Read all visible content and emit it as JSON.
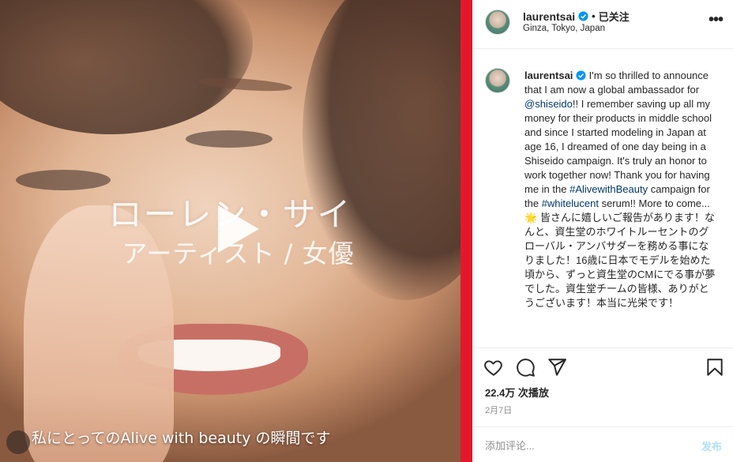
{
  "video": {
    "title_overlay": "ローレン・サイ",
    "subtitle_overlay": "アーティスト / 女優",
    "caption": "私にとってのAlive with beauty の瞬間です",
    "play_icon": "play-icon"
  },
  "post_header": {
    "username": "laurentsai",
    "separator": "•",
    "follow_label": "已关注",
    "location": "Ginza, Tokyo, Japan",
    "more_icon": "more-horizontal-icon"
  },
  "caption": {
    "username": "laurentsai",
    "text_1": " I'm so thrilled to announce that I am now a global ambassador for ",
    "mention": "@shiseido",
    "text_2": "!! I remember saving up all my money for their products in middle school and since I started modeling in Japan at age 16, I dreamed of one day being in a Shiseido campaign. It's truly an honor to work together now! Thank you for having me in the ",
    "hashtag_1": "#AlivewithBeauty",
    "text_3": " campaign for the ",
    "hashtag_2": "#whitelucent",
    "text_4": " serum!! More to come...",
    "star": "🌟",
    "jp_text": "皆さんに嬉しいご報告があります！なんと、資生堂のホワイトルーセントのグローバル・アンバサダーを務める事になりました！16歳に日本でモデルを始めた頃から、ずっと資生堂のCMにでる事が夢でした。資生堂チームの皆様、ありがとうございます！本当に光栄です！"
  },
  "actions": {
    "like_icon": "heart-icon",
    "comment_icon": "comment-icon",
    "share_icon": "send-icon",
    "save_icon": "bookmark-icon"
  },
  "stats": {
    "views": "22.4万 次播放",
    "date": "2月7日"
  },
  "comment_box": {
    "placeholder": "添加评论...",
    "post_label": "发布"
  },
  "colors": {
    "accent_stripe": "#e3192b",
    "link": "#00376b",
    "verified": "#0095f6",
    "post_disabled": "#b2dffc"
  }
}
